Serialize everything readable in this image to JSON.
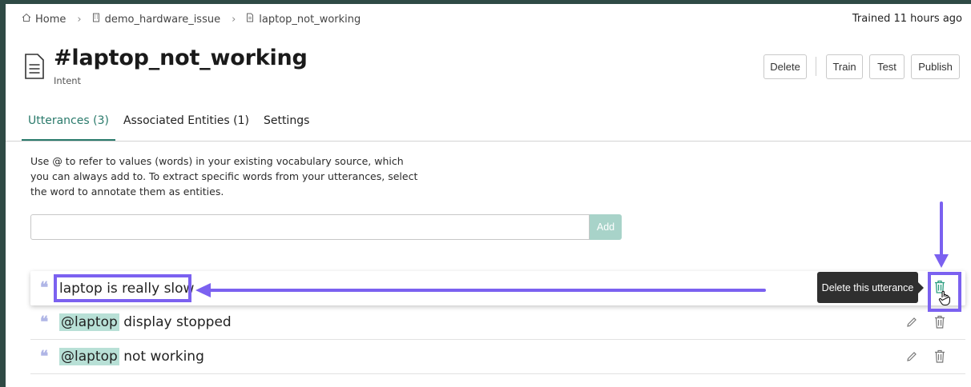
{
  "breadcrumb": {
    "home": "Home",
    "project": "demo_hardware_issue",
    "current": "laptop_not_working"
  },
  "status": {
    "trained": "Trained 11 hours ago"
  },
  "header": {
    "title": "#laptop_not_working",
    "subtitle": "Intent",
    "buttons": {
      "delete": "Delete",
      "train": "Train",
      "test": "Test",
      "publish": "Publish"
    }
  },
  "tabs": [
    {
      "label": "Utterances (3)",
      "active": true
    },
    {
      "label": "Associated Entities (1)",
      "active": false
    },
    {
      "label": "Settings",
      "active": false
    }
  ],
  "help_text": "Use @ to refer to values (words) in your existing vocabulary source, which you can always add to. To extract specific words from your utterances, select the word to annotate them as entities.",
  "utterance_input": {
    "value": "",
    "placeholder": "",
    "add_label": "Add"
  },
  "utterances": [
    {
      "entity": "",
      "text": "laptop is really slow",
      "selected": true
    },
    {
      "entity": "@laptop",
      "text": " display stopped",
      "selected": false
    },
    {
      "entity": "@laptop",
      "text": " not working",
      "selected": false
    }
  ],
  "tooltip": "Delete this utterance",
  "icons": {
    "quote": "❝",
    "home": "home-icon",
    "building": "building-icon",
    "doc": "document-icon",
    "edit": "pencil-icon",
    "trash": "trash-icon",
    "cursor": "hand-cursor-icon"
  },
  "colors": {
    "accent": "#2a7a6b",
    "entity_bg": "#b8e0d6",
    "annotation": "#7b61f0",
    "add_button": "#a8d3c9",
    "tooltip_bg": "#2f2f2f",
    "quote": "#b0b6e6",
    "trash_active": "#2a9d7f"
  }
}
